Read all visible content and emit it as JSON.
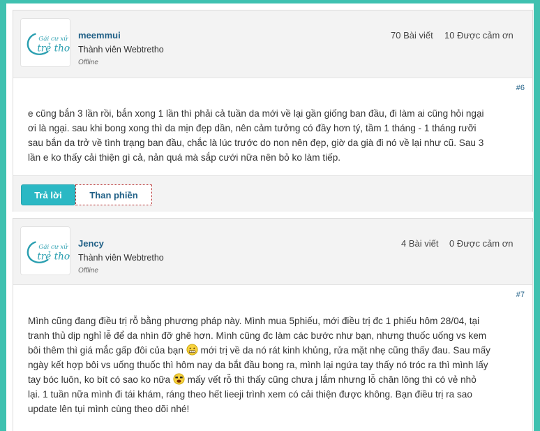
{
  "posts": [
    {
      "username": "meemmui",
      "user_title": "Thành viên Webtretho",
      "status": "Offline",
      "posts_count": "70 Bài viết",
      "thanks": "10 Được cảm ơn",
      "post_number": "#6",
      "lines": [
        "e cũng bắn 3 lần rồi, bắn xong 1 lần thì phải cả tuần da mới về lại gần giống ban đầu, đi làm ai cũng hỏi ngại",
        "ơi là ngại. sau khi bong xong thì da mịn đẹp dần, nên cảm tưởng có đầy hơn tý, tầm 1 tháng - 1 tháng rưỡi",
        "sau bắn da trở về tình trạng ban đầu, chắc là lúc trước do non nên đẹp, giờ da già đi nó về lại như cũ. Sau 3",
        "lần e ko thấy cải thiện gì cả, nản quá mà sắp cưới nữa nên bỏ ko làm tiếp."
      ],
      "reply_label": "Trả lời",
      "report_label": "Than phiền"
    },
    {
      "username": "Jency",
      "user_title": "Thành viên Webtretho",
      "status": "Offline",
      "posts_count": "4 Bài viết",
      "thanks": "0 Được cảm ơn",
      "post_number": "#7",
      "lines": [
        "Mình cũng đang điều trị rỗ bằng phương pháp này. Mình mua 5phiếu, mới điều trị đc 1 phiếu hôm 28/04, tại",
        "tranh thủ dịp nghỉ lễ để da nhìn đỡ ghê hơn. Mình cũng đc làm các bước như bạn, nhưng thuốc uống vs kem",
        "bôi thêm thì giá mắc gấp đôi của bạn",
        " mới trị về da nó rát kinh khủng, rửa mặt nhẹ cũng thấy đau. Sau mấy",
        "ngày kết hợp bôi vs uống thuốc thì hôm nay da bắt đầu bong ra, mình lại ngứa tay thấy nó tróc ra thì mình lấy",
        "tay bóc luôn, ko bít có sao ko nữa",
        " mấy vết rỗ thì thấy cũng chưa j lắm nhưng lỗ chân lông thì có vẻ nhỏ",
        "lại. 1 tuần nữa mình đi tái khám, ráng theo hết lieeji trình xem có cải thiện được không. Bạn điều trị ra sao",
        "update lên tụi mình cùng theo dõi nhé!"
      ]
    }
  ],
  "icons": {
    "avatar": "logo-icon",
    "emoji_1": "grimace-emoji-icon",
    "emoji_2": "shocked-emoji-icon"
  },
  "colors": {
    "background": "#3fc1b0",
    "username": "#1f5f86",
    "reply_button": "#2bb8c4",
    "report_border": "#b22222"
  }
}
